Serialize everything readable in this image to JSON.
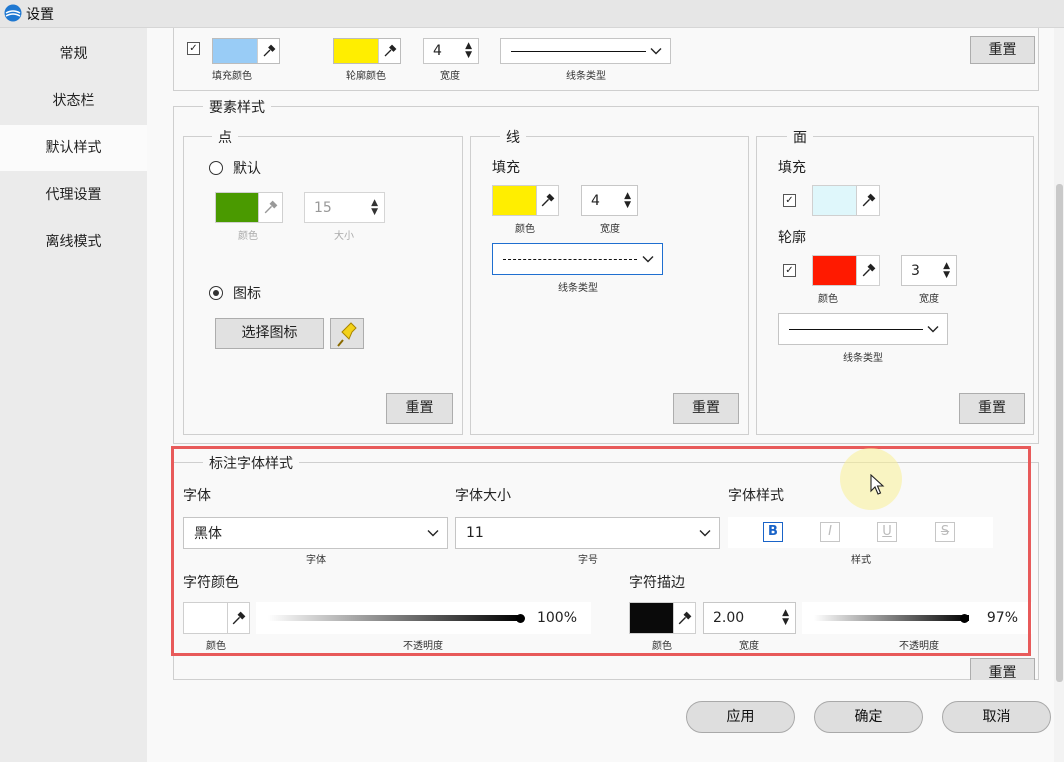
{
  "window": {
    "title": "设置"
  },
  "sidebar": {
    "items": [
      {
        "label": "常规"
      },
      {
        "label": "状态栏"
      },
      {
        "label": "默认样式"
      },
      {
        "label": "代理设置"
      },
      {
        "label": "离线模式"
      }
    ],
    "active_index": 2
  },
  "top_row": {
    "fill_label": "填充颜色",
    "fill_color": "#99ccf6",
    "outline_label": "轮廓颜色",
    "outline_color": "#ffee00",
    "width_value": "4",
    "width_label": "宽度",
    "linetype_label": "线条类型",
    "reset": "重置"
  },
  "element_style": {
    "title": "要素样式",
    "point": {
      "title": "点",
      "default_label": "默认",
      "color_label": "颜色",
      "color": "#4a9a00",
      "size_value": "15",
      "size_label": "大小",
      "icon_label": "图标",
      "choose_icon": "选择图标",
      "reset": "重置"
    },
    "line": {
      "title": "线",
      "fill_label": "填充",
      "color_label": "颜色",
      "color": "#ffee00",
      "width_value": "4",
      "width_label": "宽度",
      "linetype_label": "线条类型",
      "reset": "重置"
    },
    "polygon": {
      "title": "面",
      "fill_label": "填充",
      "fill_color": "#dff7fb",
      "outline_label": "轮廓",
      "color_label": "颜色",
      "outline_color": "#ff1a00",
      "width_value": "3",
      "width_label": "宽度",
      "linetype_label": "线条类型",
      "reset": "重置"
    }
  },
  "label_font": {
    "title": "标注字体样式",
    "font_label": "字体",
    "font_value": "黑体",
    "font_caption": "字体",
    "size_label": "字体大小",
    "size_value": "11",
    "size_caption": "字号",
    "style_label": "字体样式",
    "style_caption": "样式",
    "style_buttons": [
      "B",
      "I",
      "U",
      "S"
    ],
    "char_color_label": "字符颜色",
    "char_color": "#ffffff",
    "color_caption": "颜色",
    "opacity_caption": "不透明度",
    "char_opacity": "100%",
    "char_opacity_value": 1.0,
    "stroke_label": "字符描边",
    "stroke_color": "#0a0a0a",
    "stroke_color_caption": "颜色",
    "stroke_width_value": "2.00",
    "stroke_width_caption": "宽度",
    "stroke_opacity": "97%",
    "stroke_opacity_value": 0.97,
    "stroke_opacity_caption": "不透明度",
    "reset": "重置"
  },
  "footer": {
    "apply": "应用",
    "ok": "确定",
    "cancel": "取消"
  }
}
